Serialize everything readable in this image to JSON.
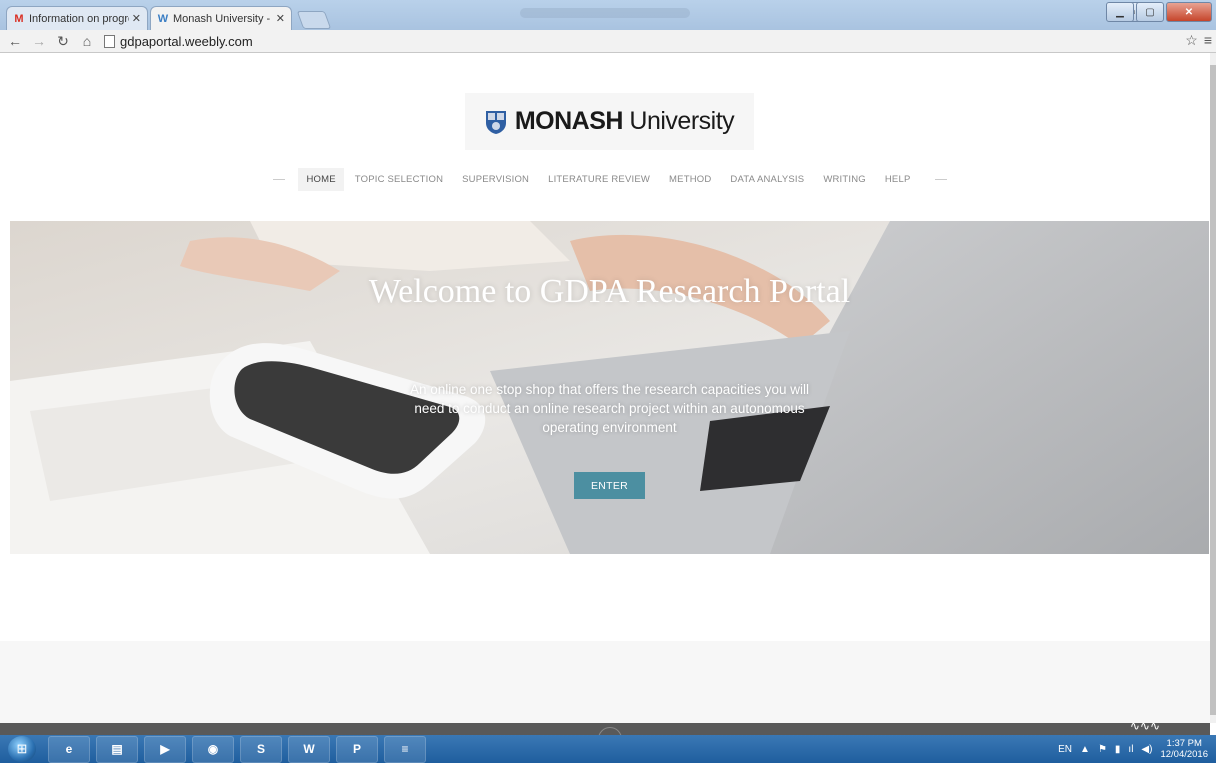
{
  "browser": {
    "tabs": [
      {
        "label": "Information on progress",
        "favicon": "M",
        "favicon_color": "#d93025"
      },
      {
        "label": "Monash University - Hom",
        "favicon": "W",
        "favicon_color": "#3b7ec4"
      }
    ],
    "url": "gdpaportal.weebly.com"
  },
  "site": {
    "logo": {
      "bold": "MONASH",
      "light": " University"
    },
    "menu": [
      "HOME",
      "TOPIC SELECTION",
      "SUPERVISION",
      "LITERATURE REVIEW",
      "METHOD",
      "DATA ANALYSIS",
      "WRITING",
      "HELP"
    ],
    "hero": {
      "title": "Welcome to GDPA Research Portal",
      "subtitle": "An online one stop shop that offers the research capacities you will need to conduct an online research project within an autonomous operating environment",
      "button": "ENTER",
      "button_color": "#4c8fa1"
    }
  },
  "taskbar": {
    "apps": [
      {
        "icon": "internet-explorer-icon",
        "glyph": "e"
      },
      {
        "icon": "file-explorer-icon",
        "glyph": "▤"
      },
      {
        "icon": "media-player-icon",
        "glyph": "▶"
      },
      {
        "icon": "chrome-icon",
        "glyph": "◉"
      },
      {
        "icon": "skype-icon",
        "glyph": "S"
      },
      {
        "icon": "word-icon",
        "glyph": "W"
      },
      {
        "icon": "powerpoint-icon",
        "glyph": "P"
      },
      {
        "icon": "app-icon",
        "glyph": "≡"
      }
    ],
    "language": "EN",
    "time": "1:37 PM",
    "date": "12/04/2016"
  }
}
